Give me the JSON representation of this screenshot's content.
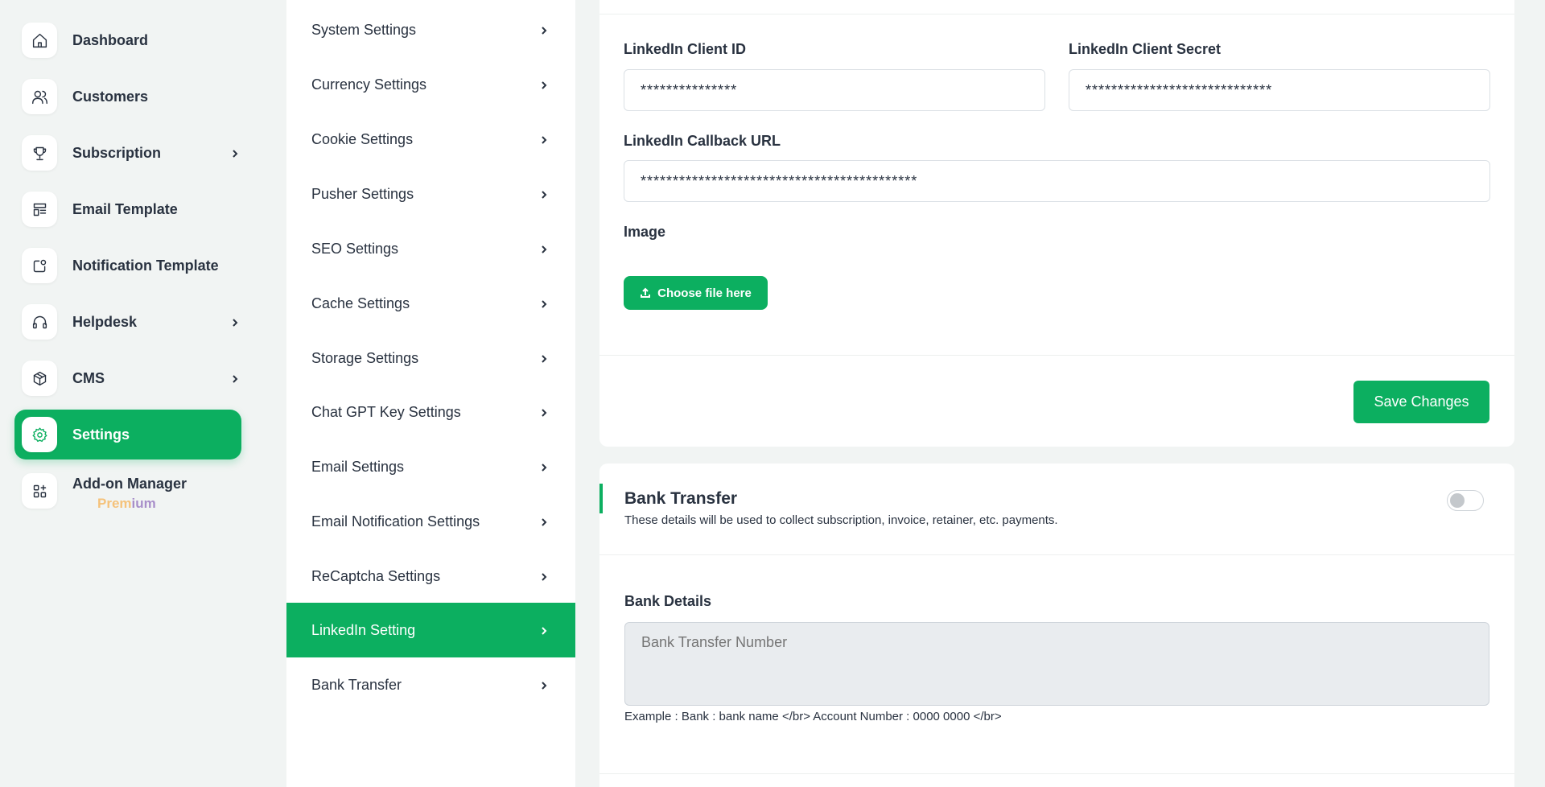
{
  "sidebar": {
    "items": [
      {
        "label": "Dashboard",
        "icon": "home-icon"
      },
      {
        "label": "Customers",
        "icon": "users-icon"
      },
      {
        "label": "Subscription",
        "icon": "trophy-icon"
      },
      {
        "label": "Email Template",
        "icon": "template-icon"
      },
      {
        "label": "Notification Template",
        "icon": "notification-icon"
      },
      {
        "label": "Helpdesk",
        "icon": "headset-icon"
      },
      {
        "label": "CMS",
        "icon": "package-icon"
      },
      {
        "label": "Settings",
        "icon": "gear-icon"
      },
      {
        "label": "Add-on Manager",
        "icon": "apps-add-icon"
      }
    ],
    "premium_part1": "Prem",
    "premium_part2": "ium",
    "active": "Settings"
  },
  "settings_menu": {
    "items": [
      "System Settings",
      "Currency Settings",
      "Cookie Settings",
      "Pusher Settings",
      "SEO Settings",
      "Cache Settings",
      "Storage Settings",
      "Chat GPT Key Settings",
      "Email Settings",
      "Email Notification Settings",
      "ReCaptcha Settings",
      "LinkedIn Setting",
      "Bank Transfer"
    ],
    "active": "LinkedIn Setting"
  },
  "linkedin": {
    "client_id_label": "LinkedIn Client ID",
    "client_id_value": "***************",
    "client_secret_label": "LinkedIn Client Secret",
    "client_secret_value": "*****************************",
    "callback_label": "LinkedIn Callback URL",
    "callback_value": "*******************************************",
    "image_label": "Image",
    "choose_file_label": "Choose file here",
    "save_label": "Save Changes"
  },
  "bank_transfer": {
    "title": "Bank Transfer",
    "subtitle": "These details will be used to collect subscription, invoice, retainer, etc. payments.",
    "enabled": false,
    "bank_details_label": "Bank Details",
    "bank_details_placeholder": "Bank Transfer Number",
    "example": "Example : Bank : bank name </br> Account Number : 0000 0000 </br>"
  },
  "colors": {
    "accent": "#0caf60",
    "text": "#293240",
    "background": "#f1f4f3"
  }
}
